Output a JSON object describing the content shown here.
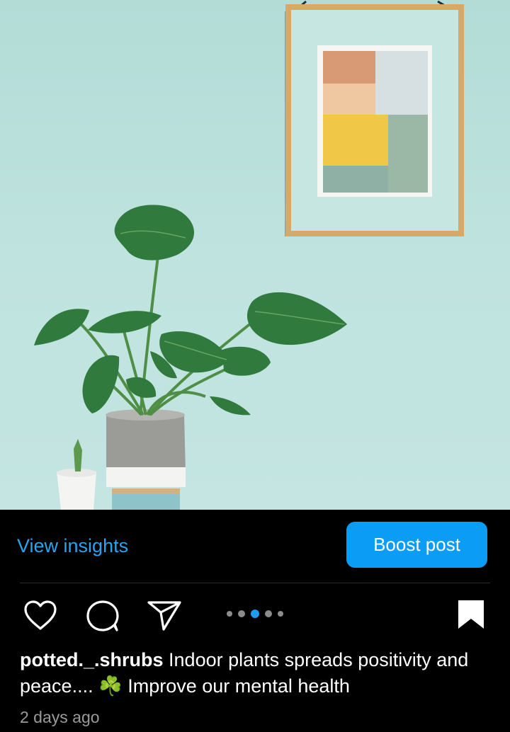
{
  "post": {
    "image_alt_subject": "plant-photo",
    "carousel": {
      "count": 5,
      "active_index": 2
    }
  },
  "actions": {
    "view_insights": "View insights",
    "boost_post": "Boost post"
  },
  "caption": {
    "username": "potted._.shrubs",
    "text_before_emoji": "Indoor plants spreads positivity and peace....",
    "emoji": "☘️",
    "text_after_emoji": "Improve our mental health"
  },
  "timestamp": "2 days ago",
  "icons": {
    "like": "heart-icon",
    "comment": "comment-icon",
    "share": "send-icon",
    "save": "bookmark-icon"
  },
  "colors": {
    "accent": "#0b9cf5",
    "link": "#2aa4ef",
    "background": "#000000",
    "wall": "#bfe3df"
  }
}
